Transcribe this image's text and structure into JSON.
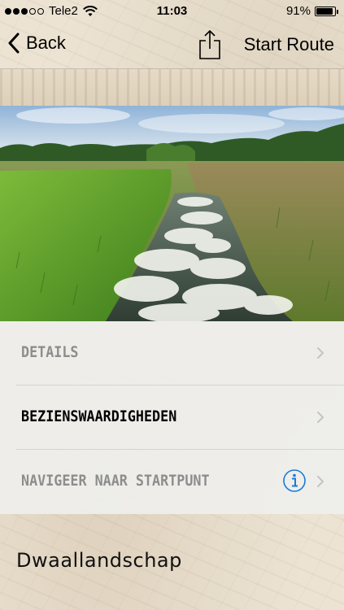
{
  "status_bar": {
    "carrier": "Tele2",
    "signal_bars": 3,
    "time": "11:03",
    "battery_percent": "91%",
    "battery_level": 0.91
  },
  "nav": {
    "back_label": "Back",
    "share_icon": "share-icon",
    "start_route_label": "Start Route"
  },
  "menu": {
    "items": [
      {
        "label": "DETAILS",
        "enabled": false
      },
      {
        "label": "BEZIENSWAARDIGHEDEN",
        "enabled": true
      },
      {
        "label": "NAVIGEER NAAR STARTPUNT",
        "enabled": false,
        "icon": "info-icon"
      }
    ]
  },
  "footer": {
    "title": "Dwaallandschap"
  },
  "colors": {
    "accent_blue": "#1a7ad6",
    "disabled_text": "#8d8d8d",
    "panel": "#eeeeec"
  }
}
